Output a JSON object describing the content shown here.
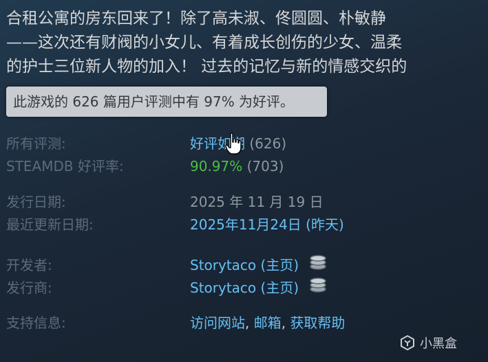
{
  "description": {
    "line1": "合租公寓的房东回来了！除了高未淑、佟圆圆、朴敏静",
    "line2": "——这次还有财阀的小女儿、有着成长创伤的少女、温柔",
    "line3": "的护士三位新人物的加入！ 过去的记忆与新的情感交织的"
  },
  "tooltip": "此游戏的 626 篇用户评测中有 97% 为好评。",
  "reviews": {
    "all_label": "所有评测:",
    "all_rating": "好评如潮",
    "all_count": "(626)",
    "steamdb_label": "STEAMDB 好评率:",
    "steamdb_pct": "90.97%",
    "steamdb_count": "(703)"
  },
  "dates": {
    "release_label": "发行日期:",
    "release_value": "2025 年 11 月 19 日",
    "update_label": "最近更新日期:",
    "update_value": "2025年11月24日 (昨天)"
  },
  "company": {
    "developer_label": "开发者:",
    "developer_name": "Storytaco",
    "developer_home": "(主页)",
    "publisher_label": "发行商:",
    "publisher_name": "Storytaco",
    "publisher_home": "(主页)",
    "coin_icon": "coin-stack-icon"
  },
  "support": {
    "label": "支持信息:",
    "visit_site": "访问网站",
    "sep1": ",",
    "email": "邮箱",
    "sep2": ",",
    "get_help": "获取帮助"
  },
  "watermark": {
    "text": "小黑盒"
  },
  "colors": {
    "background": "#1b2838",
    "link_blue": "#66c0f4",
    "positive_green": "#4ebf45",
    "label_grey": "#5b6b7b",
    "value_grey": "#8f98a0"
  }
}
